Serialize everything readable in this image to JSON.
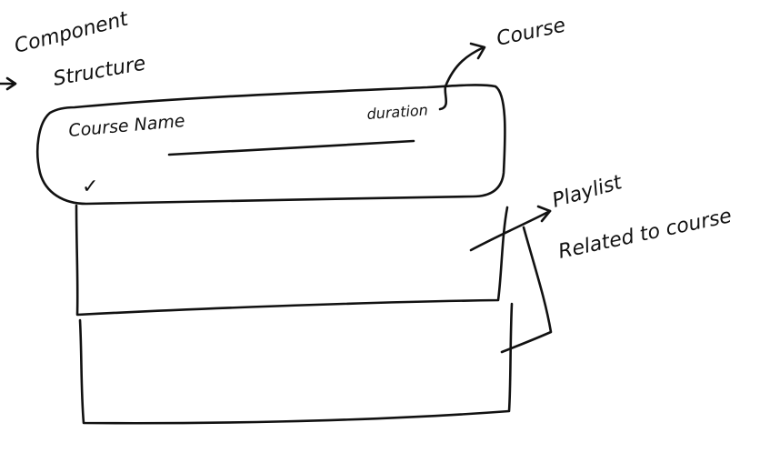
{
  "labels": {
    "component_structure_line1": "Component",
    "component_structure_line2": "Structure",
    "course_arrow_label": "Course",
    "course_name": "Course Name",
    "duration": "duration",
    "playlist_line1": "Playlist",
    "playlist_line2": "Related to course",
    "check_mark": "✓"
  },
  "colors": {
    "ink": "#111111",
    "paper": "#ffffff"
  }
}
